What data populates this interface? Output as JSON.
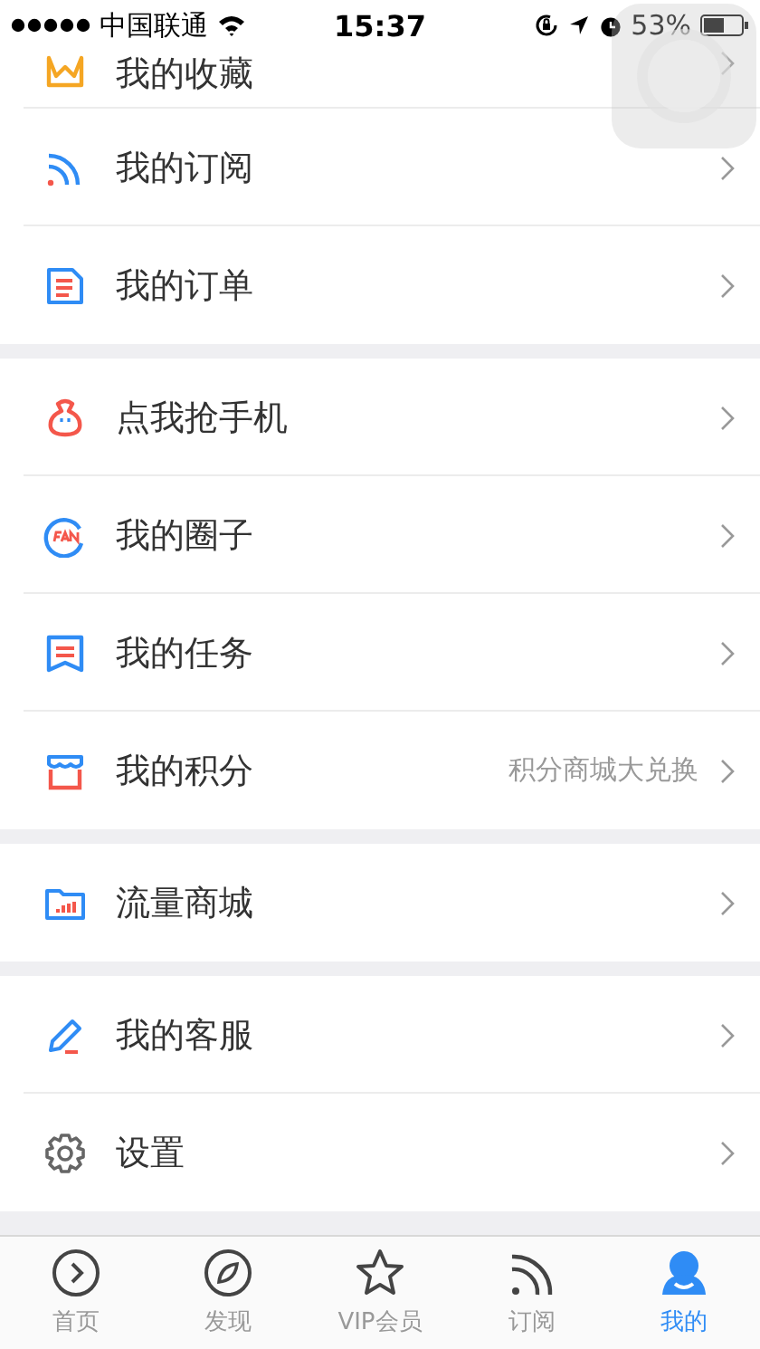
{
  "status_bar": {
    "carrier": "中国联通",
    "time": "15:37",
    "battery": "53%"
  },
  "sections": [
    {
      "items": [
        {
          "label": "我的收藏"
        },
        {
          "label": "我的订阅"
        },
        {
          "label": "我的订单"
        }
      ]
    },
    {
      "items": [
        {
          "label": "点我抢手机"
        },
        {
          "label": "我的圈子"
        },
        {
          "label": "我的任务"
        },
        {
          "label": "我的积分",
          "note": "积分商城大兑换"
        }
      ]
    },
    {
      "items": [
        {
          "label": "流量商城"
        }
      ]
    },
    {
      "items": [
        {
          "label": "我的客服"
        },
        {
          "label": "设置"
        }
      ]
    }
  ],
  "tab_bar": [
    {
      "label": "首页",
      "selected": false
    },
    {
      "label": "发现",
      "selected": false
    },
    {
      "label": "VIP会员",
      "selected": false
    },
    {
      "label": "订阅",
      "selected": false
    },
    {
      "label": "我的",
      "selected": true
    }
  ]
}
